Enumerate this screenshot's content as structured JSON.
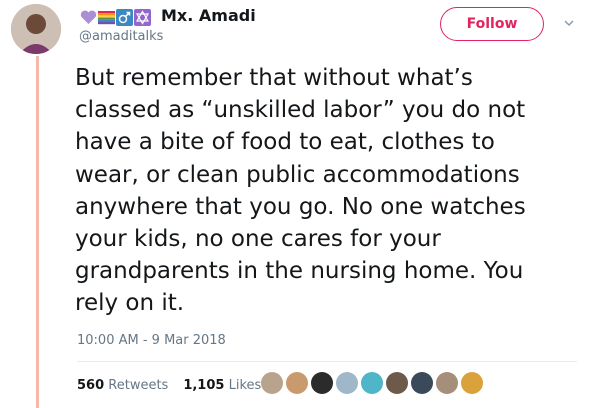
{
  "user": {
    "display_name": "Mx. Amadi",
    "handle": "@amaditalks",
    "badges": [
      "purple-heart-icon",
      "rainbow-flag-icon",
      "gender-symbol-icon",
      "star-of-david-icon"
    ]
  },
  "follow_label": "Follow",
  "tweet": {
    "text": "But remember that without what’s\nclassed as “unskilled labor” you do not\nhave a bite of food to eat, clothes to\nwear, or clean public accommodations\nanywhere that you go. No one watches\nyour kids, no one cares for your\ngrandparents in the nursing home. You\nrely on it.",
    "timestamp": "10:00 AM - 9 Mar 2018"
  },
  "stats": {
    "retweets_count": "560",
    "retweets_label": "Retweets",
    "likes_count": "1,105",
    "likes_label": "Likes"
  },
  "liker_colors": [
    "#b8a48c",
    "#c89a6e",
    "#2b2b2b",
    "#9fb7c9",
    "#4fb5c8",
    "#6d5a4a",
    "#3a4a5a",
    "#a58e7a",
    "#d9a23b"
  ],
  "colors": {
    "accent": "#e0245e",
    "thread": "#f4b9a9"
  }
}
